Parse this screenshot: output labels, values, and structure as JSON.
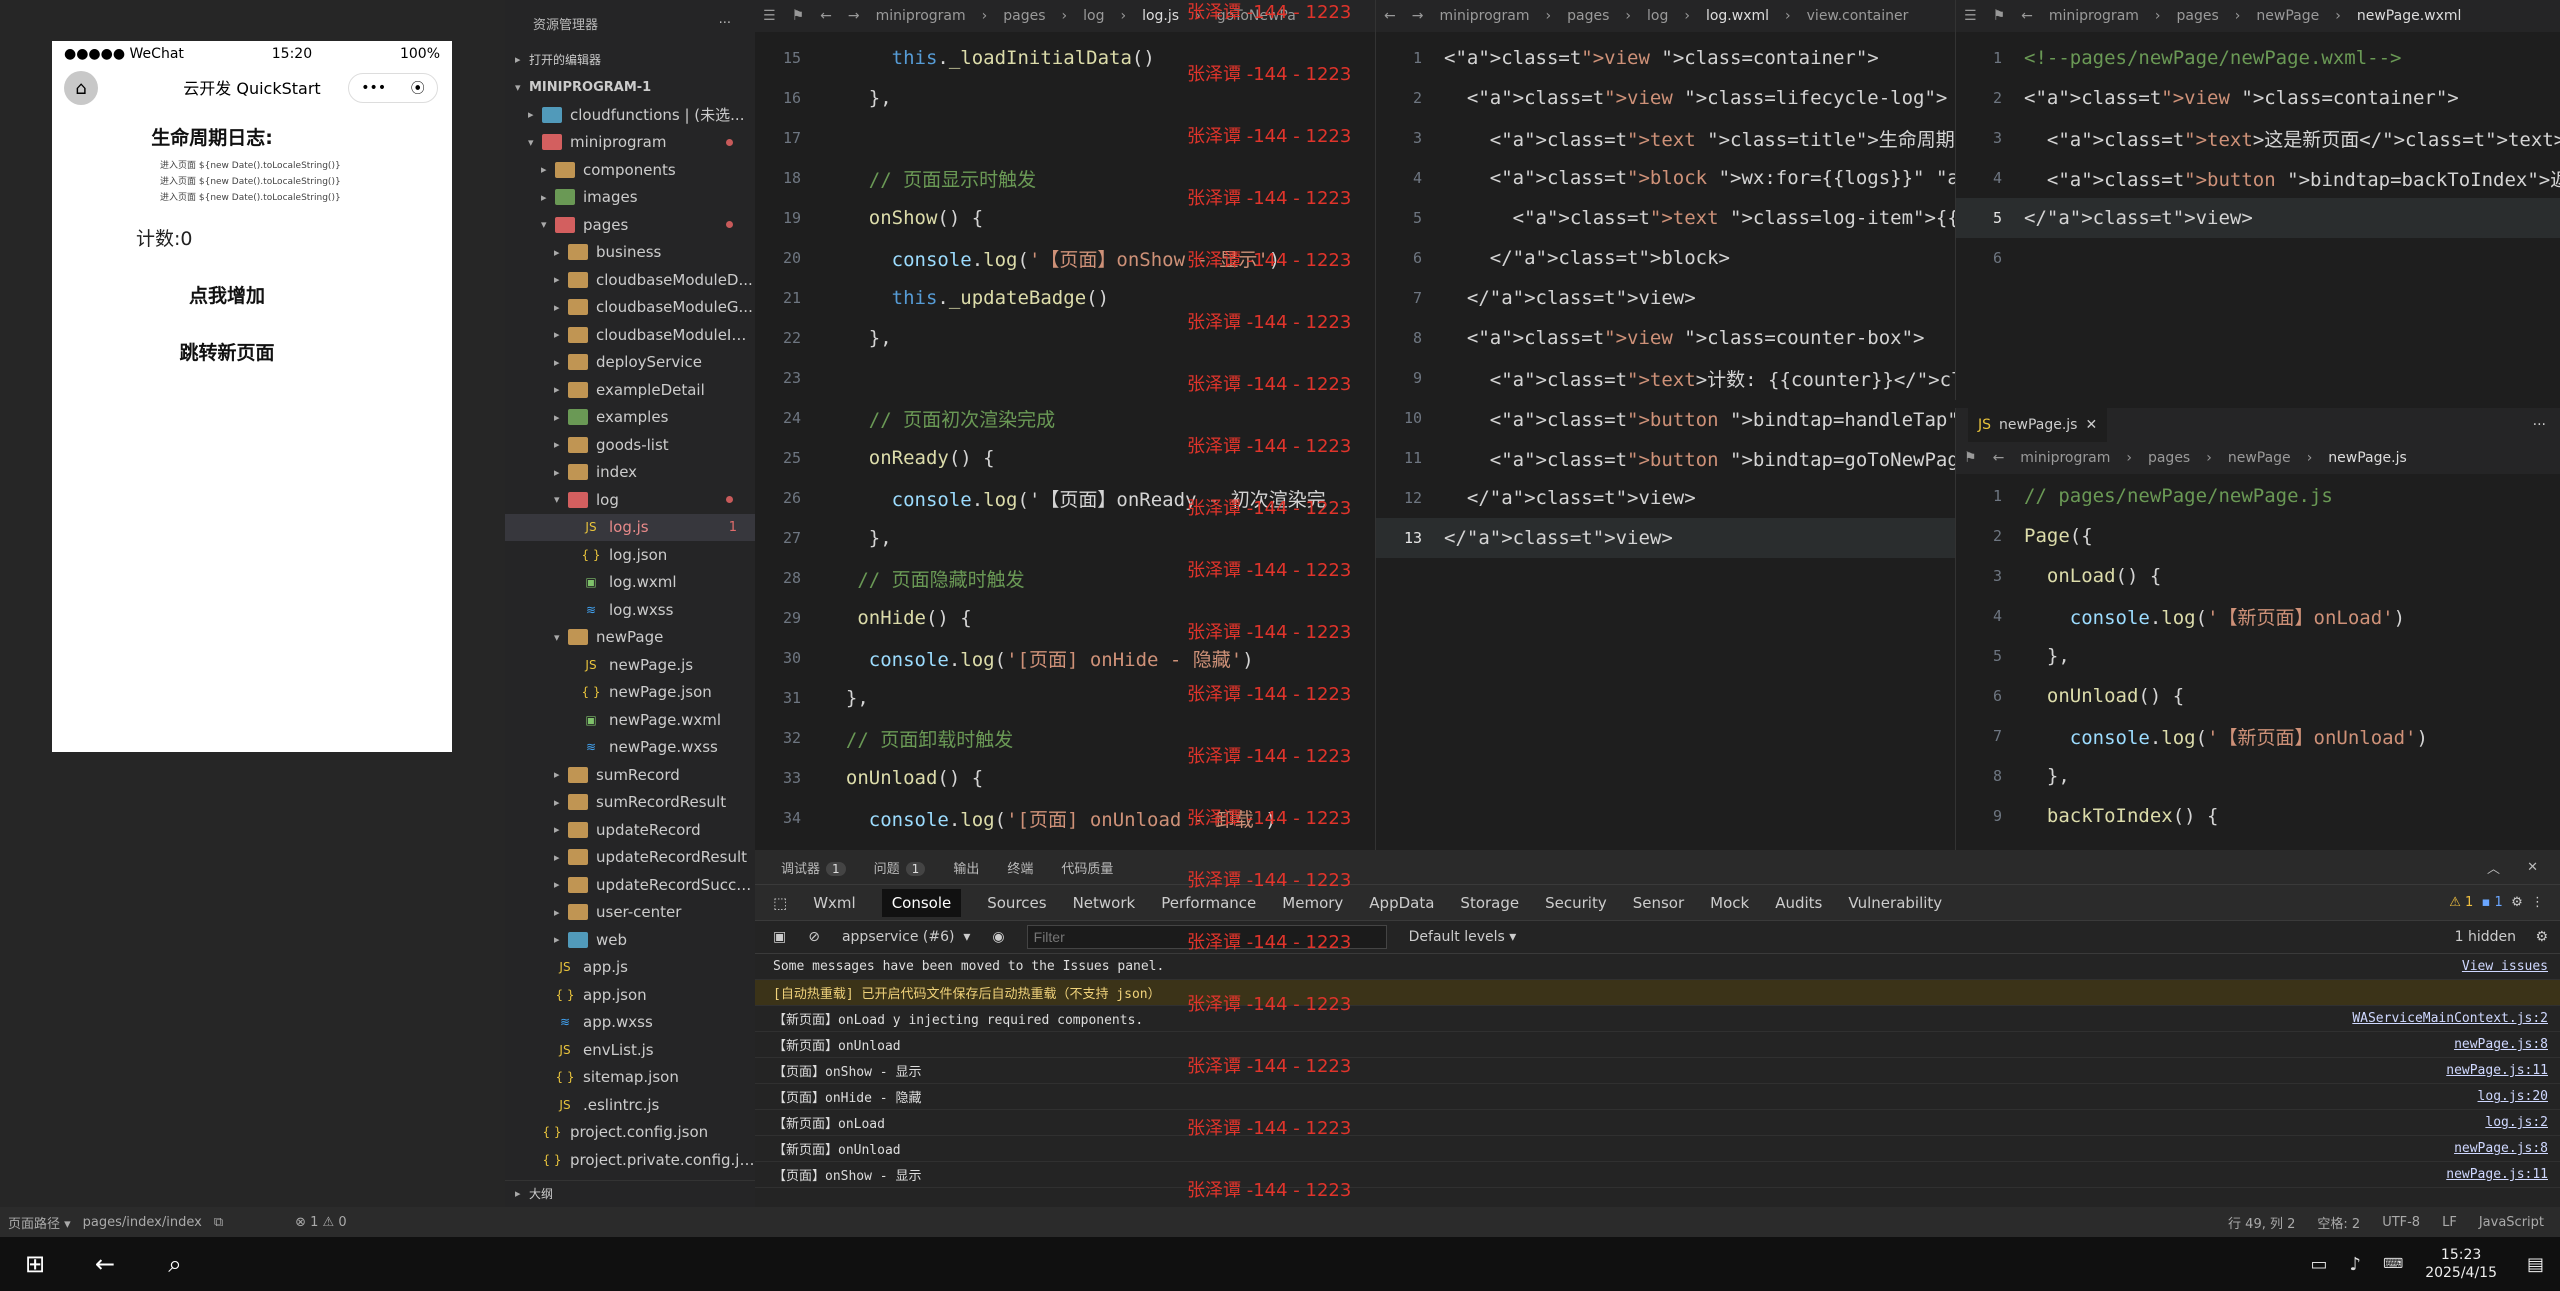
{
  "simulator": {
    "status_left": "●●●●● WeChat",
    "status_time": "15:20",
    "status_battery": "100%",
    "nav_title": "云开发 QuickStart",
    "capsule_more": "•••",
    "capsule_close": "⦿",
    "page_title": "生命周期日志:",
    "log_lines": [
      "进入页面 ${new Date().toLocaleString()}",
      "进入页面 ${new Date().toLocaleString()}",
      "进入页面 ${new Date().toLocaleString()}"
    ],
    "counter_text": "计数:0",
    "btn_increment": "点我增加",
    "btn_goto": "跳转新页面"
  },
  "explorer": {
    "header": "资源管理器",
    "more": "···",
    "open_editors": "打开的编辑器",
    "root": "MINIPROGRAM-1",
    "items": [
      {
        "label": "cloudfunctions | (未选..."
      },
      {
        "label": "miniprogram"
      },
      {
        "label": "components"
      },
      {
        "label": "images"
      },
      {
        "label": "pages"
      },
      {
        "label": "business"
      },
      {
        "label": "cloudbaseModuleD..."
      },
      {
        "label": "cloudbaseModuleG..."
      },
      {
        "label": "cloudbaseModuleIn..."
      },
      {
        "label": "deployService"
      },
      {
        "label": "exampleDetail"
      },
      {
        "label": "examples"
      },
      {
        "label": "goods-list"
      },
      {
        "label": "index"
      },
      {
        "label": "log"
      },
      {
        "label": "log.js",
        "badge": "1"
      },
      {
        "label": "log.json"
      },
      {
        "label": "log.wxml"
      },
      {
        "label": "log.wxss"
      },
      {
        "label": "newPage"
      },
      {
        "label": "newPage.js"
      },
      {
        "label": "newPage.json"
      },
      {
        "label": "newPage.wxml"
      },
      {
        "label": "newPage.wxss"
      },
      {
        "label": "sumRecord"
      },
      {
        "label": "sumRecordResult"
      },
      {
        "label": "updateRecord"
      },
      {
        "label": "updateRecordResult"
      },
      {
        "label": "updateRecordSuccess"
      },
      {
        "label": "user-center"
      },
      {
        "label": "web"
      },
      {
        "label": "app.js"
      },
      {
        "label": "app.json"
      },
      {
        "label": "app.wxss"
      },
      {
        "label": "envList.js"
      },
      {
        "label": "sitemap.json"
      },
      {
        "label": ".eslintrc.js"
      },
      {
        "label": "project.config.json"
      },
      {
        "label": "project.private.config.js..."
      }
    ],
    "outline": "大纲"
  },
  "editor_js": {
    "breadcrumb": [
      "miniprogram",
      "pages",
      "log",
      "log.js",
      "goToNewPa"
    ],
    "lines": [
      {
        "n": "15",
        "code": "      this._loadInitialData()"
      },
      {
        "n": "16",
        "code": "    },"
      },
      {
        "n": "17",
        "code": ""
      },
      {
        "n": "18",
        "code": "    // 页面显示时触发"
      },
      {
        "n": "19",
        "code": "    onShow() {"
      },
      {
        "n": "20",
        "code": "      console.log('【页面】onShow - 显示')"
      },
      {
        "n": "21",
        "code": "      this._updateBadge()"
      },
      {
        "n": "22",
        "code": "    },"
      },
      {
        "n": "23",
        "code": ""
      },
      {
        "n": "24",
        "code": "    // 页面初次渲染完成"
      },
      {
        "n": "25",
        "code": "    onReady() {"
      },
      {
        "n": "26",
        "code": "      console.log('【页面】onReady - 初次渲染完"
      },
      {
        "n": "27",
        "code": "    },"
      },
      {
        "n": "28",
        "code": "   // 页面隐藏时触发"
      },
      {
        "n": "29",
        "code": "   onHide() {"
      },
      {
        "n": "30",
        "code": "    console.log('[页面] onHide - 隐藏')"
      },
      {
        "n": "31",
        "code": "  },"
      },
      {
        "n": "32",
        "code": "  // 页面卸载时触发"
      },
      {
        "n": "33",
        "code": "  onUnload() {"
      },
      {
        "n": "34",
        "code": "    console.log('[页面] onUnload - 卸载')"
      }
    ]
  },
  "editor_wxml": {
    "breadcrumb": [
      "miniprogram",
      "pages",
      "log",
      "log.wxml",
      "view.container"
    ],
    "lines": [
      {
        "n": "1",
        "code": "<view class=\"container\">"
      },
      {
        "n": "2",
        "code": "  <view class=\"lifecycle-log\">"
      },
      {
        "n": "3",
        "code": "    <text class=\"title\">生命周期日志:</text>"
      },
      {
        "n": "4",
        "code": "    <block wx:for=\"{{logs}}\" wx:key=\"index\">"
      },
      {
        "n": "5",
        "code": "      <text class=\"log-item\">{{item}}</text>"
      },
      {
        "n": "6",
        "code": "    </block>"
      },
      {
        "n": "7",
        "code": "  </view>"
      },
      {
        "n": "8",
        "code": "  <view class=\"counter-box\">"
      },
      {
        "n": "9",
        "code": "    <text>计数: {{counter}}</text>"
      },
      {
        "n": "10",
        "code": "    <button bindtap=\"handleTap\">点我增加</button>"
      },
      {
        "n": "11",
        "code": "    <button bindtap=\"goToNewPage\">跳转新页面</bu"
      },
      {
        "n": "12",
        "code": "  </view>"
      },
      {
        "n": "13",
        "code": "</view>"
      }
    ]
  },
  "editor_newpage_wxml": {
    "breadcrumb": [
      "miniprogram",
      "pages",
      "newPage",
      "newPage.wxml"
    ],
    "lines": [
      {
        "n": "1",
        "code": "<!--pages/newPage/newPage.wxml-->"
      },
      {
        "n": "2",
        "code": "<view class=\"container\">"
      },
      {
        "n": "3",
        "code": "  <text>这是新页面</text>"
      },
      {
        "n": "4",
        "code": "  <button bindtap=\"backToIndex\">返回首页</butt"
      },
      {
        "n": "5",
        "code": "</view>"
      },
      {
        "n": "6",
        "code": ""
      }
    ]
  },
  "editor_newpage_js": {
    "tab": "newPage.js",
    "breadcrumb": [
      "miniprogram",
      "pages",
      "newPage",
      "newPage.js"
    ],
    "lines": [
      {
        "n": "1",
        "code": "// pages/newPage/newPage.js"
      },
      {
        "n": "2",
        "code": "Page({"
      },
      {
        "n": "3",
        "code": "  onLoad() {"
      },
      {
        "n": "4",
        "code": "    console.log('【新页面】onLoad')"
      },
      {
        "n": "5",
        "code": "  },"
      },
      {
        "n": "6",
        "code": "  onUnload() {"
      },
      {
        "n": "7",
        "code": "    console.log('【新页面】onUnload')"
      },
      {
        "n": "8",
        "code": "  },"
      },
      {
        "n": "9",
        "code": "  backToIndex() {"
      }
    ]
  },
  "watermark": "张泽谭 -144 - 1223",
  "console": {
    "panel_tabs": [
      "调试器",
      "问题",
      "输出",
      "终端",
      "代码质量"
    ],
    "debugger_count": "1",
    "problems_count": "1",
    "devtools_tabs": [
      "Wxml",
      "Console",
      "Sources",
      "Network",
      "Performance",
      "Memory",
      "AppData",
      "Storage",
      "Security",
      "Sensor",
      "Mock",
      "Audits",
      "Vulnerability"
    ],
    "context": "appservice (#6)",
    "filter_placeholder": "Filter",
    "levels": "Default levels ▾",
    "hidden": "1 hidden",
    "warn_count": "1",
    "info_count": "1",
    "messages": [
      {
        "text": "Some messages have been moved to the Issues panel.",
        "src": "View issues",
        "type": "info"
      },
      {
        "text": "[自动热重载] 已开启代码文件保存后自动热重载（不支持 json）",
        "src": "",
        "type": "warn"
      },
      {
        "text": "【新页面】onLoad                 y injecting required components.",
        "src": "WAServiceMainContext.js:2",
        "type": "log"
      },
      {
        "text": "【新页面】onUnload",
        "src": "newPage.js:8",
        "type": "log"
      },
      {
        "text": "【页面】onShow - 显示",
        "src": "newPage.js:11",
        "type": "log"
      },
      {
        "text": "【页面】onHide - 隐藏",
        "src": "log.js:20",
        "type": "log"
      },
      {
        "text": "【新页面】onLoad",
        "src": "log.js:2",
        "type": "log"
      },
      {
        "text": "【新页面】onUnload",
        "src": "newPage.js:8",
        "type": "log"
      },
      {
        "text": "【页面】onShow - 显示",
        "src": "newPage.js:11",
        "type": "log"
      }
    ]
  },
  "status": {
    "page_path_label": "页面路径 ▾",
    "page_path": "pages/index/index",
    "problems": "⊗ 1 ⚠ 0",
    "cursor": "行 49, 列 2",
    "spaces": "空格: 2",
    "encoding": "UTF-8",
    "eol": "LF",
    "language": "JavaScript"
  },
  "taskbar": {
    "time": "15:23",
    "date": "2025/4/15"
  }
}
